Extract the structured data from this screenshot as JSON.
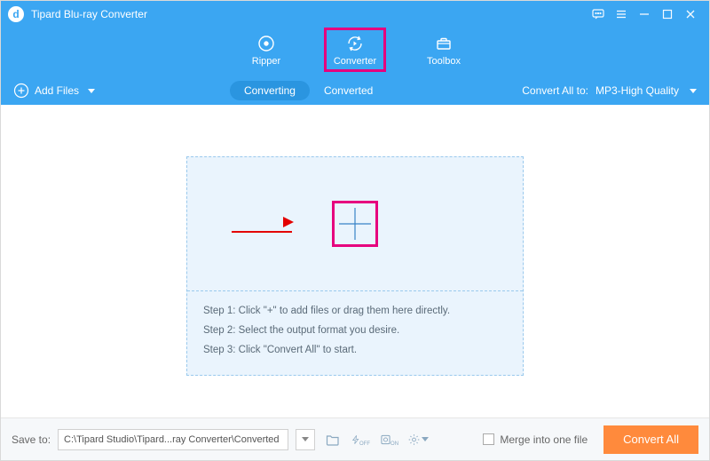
{
  "title": "Tipard Blu-ray Converter",
  "nav": {
    "ripper": "Ripper",
    "converter": "Converter",
    "toolbox": "Toolbox"
  },
  "subbar": {
    "add_files": "Add Files",
    "converting": "Converting",
    "converted": "Converted",
    "convert_all_to_label": "Convert All to:",
    "format": "MP3-High Quality"
  },
  "dropzone": {
    "step1": "Step 1: Click \"+\" to add files or drag them here directly.",
    "step2": "Step 2: Select the output format you desire.",
    "step3": "Step 3: Click \"Convert All\" to start."
  },
  "footer": {
    "save_to_label": "Save to:",
    "path": "C:\\Tipard Studio\\Tipard...ray Converter\\Converted",
    "merge_label": "Merge into one file",
    "convert_all": "Convert All"
  }
}
